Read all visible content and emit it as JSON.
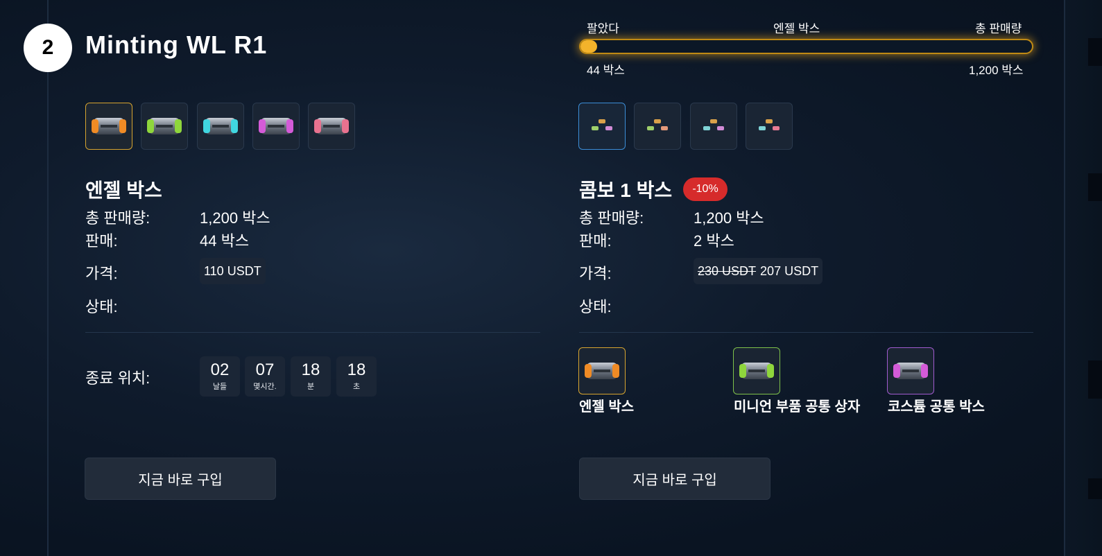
{
  "round": {
    "number": "2",
    "title": "Minting WL R1"
  },
  "progress": {
    "sold_label": "팔았다",
    "box_label": "엔젤 박스",
    "total_label": "총 판매량",
    "sold_value": "44 박스",
    "total_value": "1,200 박스",
    "fraction": 0.0367
  },
  "left_product": {
    "thumbs": [
      {
        "icon": "orange-crate-icon",
        "color": "#f08b25",
        "selected": true
      },
      {
        "icon": "green-crate-icon",
        "color": "#8fd63c",
        "selected": false
      },
      {
        "icon": "cyan-crate-icon",
        "color": "#40d6e0",
        "selected": false
      },
      {
        "icon": "purple-crate-icon",
        "color": "#d45bd8",
        "selected": false
      },
      {
        "icon": "pink-crate-icon",
        "color": "#e8728f",
        "selected": false
      }
    ],
    "title": "엔젤 박스",
    "total_label": "총 판매량:",
    "total_value": "1,200 박스",
    "sold_label": "판매:",
    "sold_value": "44 박스",
    "price_label": "가격:",
    "price_value": "110 USDT",
    "status_label": "상태:",
    "end_label": "종료 위치:",
    "countdown": [
      {
        "value": "02",
        "unit": "날들"
      },
      {
        "value": "07",
        "unit": "몇시간."
      },
      {
        "value": "18",
        "unit": "분"
      },
      {
        "value": "18",
        "unit": "초"
      }
    ],
    "buy_label": "지금 바로 구입"
  },
  "right_product": {
    "thumbs": [
      {
        "icon": "combo-1-icon",
        "selected": true
      },
      {
        "icon": "combo-2-icon",
        "selected": false
      },
      {
        "icon": "combo-3-icon",
        "selected": false
      },
      {
        "icon": "combo-4-icon",
        "selected": false
      }
    ],
    "title": "콤보 1 박스",
    "discount_badge": "-10%",
    "total_label": "총 판매량:",
    "total_value": "1,200 박스",
    "sold_label": "판매:",
    "sold_value": "2 박스",
    "price_label": "가격:",
    "price_original": "230 USDT",
    "price_value": "207 USDT",
    "status_label": "상태:",
    "contents": [
      {
        "name": "엔젤 박스",
        "icon": "orange-crate-icon",
        "color": "#f08b25",
        "border": "#d8a52f"
      },
      {
        "name": "미니언 부품 공통 상자",
        "icon": "green-crate-icon",
        "color": "#8fd63c",
        "border": "#7fc24a"
      },
      {
        "name": "코스튬 공통 박스",
        "icon": "purple-crate-icon",
        "color": "#d45bd8",
        "border": "#a15bd0"
      }
    ],
    "buy_label": "지금 바로 구입"
  }
}
